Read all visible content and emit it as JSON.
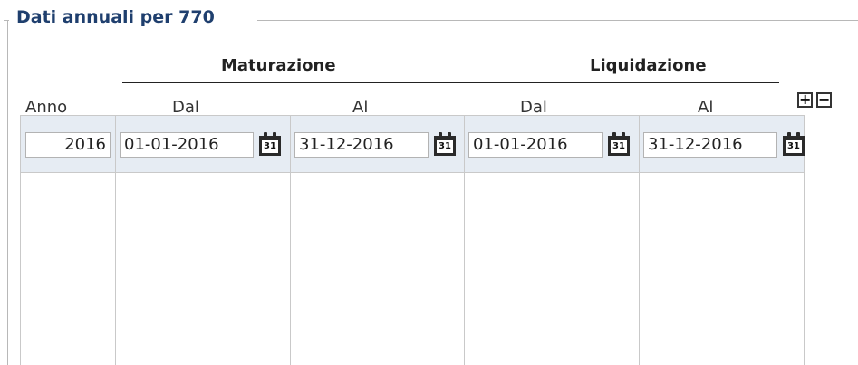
{
  "legend": "Dati annuali per 770",
  "groups": {
    "maturazione": "Maturazione",
    "liquidazione": "Liquidazione"
  },
  "columns": {
    "anno": "Anno",
    "mat_dal": "Dal",
    "mat_al": "Al",
    "liq_dal": "Dal",
    "liq_al": "Al"
  },
  "buttons": {
    "add": "+",
    "remove": "−"
  },
  "rows": [
    {
      "anno": "2016",
      "mat_dal": "01-01-2016",
      "mat_al": "31-12-2016",
      "liq_dal": "01-01-2016",
      "liq_al": "31-12-2016"
    }
  ],
  "calendar_icon_day": "31"
}
